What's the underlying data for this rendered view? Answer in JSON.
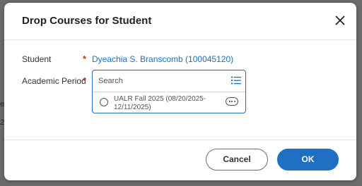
{
  "backdrop": {
    "fragments": [
      "e",
      "2"
    ]
  },
  "dialog": {
    "title": "Drop Courses for Student",
    "close_icon": "close-icon"
  },
  "form": {
    "student_label": "Student",
    "student_required": "*",
    "student_value": "Dyeachia S. Branscomb (100045120)",
    "period_label": "Academic Period",
    "period_required": "*",
    "search": {
      "placeholder": "Search",
      "value": ""
    },
    "prompt_icon": "list-prompt-icon",
    "options": [
      {
        "label": "UALR Fall 2025 (08/20/2025-12/11/2025)",
        "selected": false,
        "action_icon": "more-options-icon"
      }
    ]
  },
  "footer": {
    "cancel_label": "Cancel",
    "ok_label": "OK"
  },
  "colors": {
    "accent": "#1f6fc5",
    "required": "#d0342c",
    "overlay": "#6b6b6b"
  }
}
